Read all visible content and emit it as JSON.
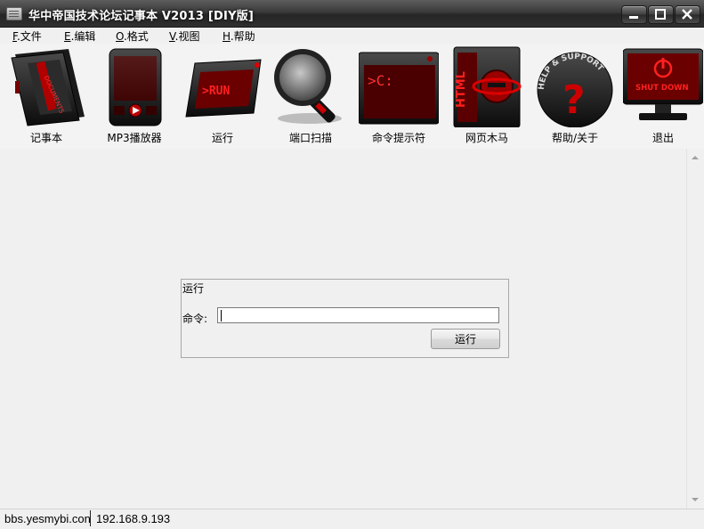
{
  "window": {
    "title": "华中帝国技术论坛记事本 V2013 [DIY版]"
  },
  "menu": [
    {
      "key": "F",
      "label": ".文件"
    },
    {
      "key": "E",
      "label": ".编辑"
    },
    {
      "key": "O",
      "label": ".格式"
    },
    {
      "key": "V",
      "label": ".视图"
    },
    {
      "key": "H",
      "label": ".帮助"
    }
  ],
  "toolbar": [
    {
      "label": "记事本",
      "icon": "notebook-icon"
    },
    {
      "label": "MP3播放器",
      "icon": "mp3-player-icon"
    },
    {
      "label": "运行",
      "icon": "run-icon",
      "art": ">RUN"
    },
    {
      "label": "端口扫描",
      "icon": "magnifier-icon"
    },
    {
      "label": "命令提示符",
      "icon": "command-prompt-icon",
      "art": ">C:"
    },
    {
      "label": "网页木马",
      "icon": "html-web-icon",
      "art": "HTML"
    },
    {
      "label": "帮助/关于",
      "icon": "help-support-icon",
      "art": "HELP & SUPPORT"
    },
    {
      "label": "退出",
      "icon": "shutdown-icon",
      "art": "SHUT DOWN"
    }
  ],
  "notebook_art": "DOCUMENTS",
  "run_dialog": {
    "title": "运行",
    "command_label": "命令:",
    "command_value": "",
    "button_label": "运行"
  },
  "status": {
    "url": "bbs.yesmybi.con",
    "ip": "192.168.9.193"
  },
  "colors": {
    "accent_red": "#d41010",
    "titlebar": "#2f2f2f"
  }
}
